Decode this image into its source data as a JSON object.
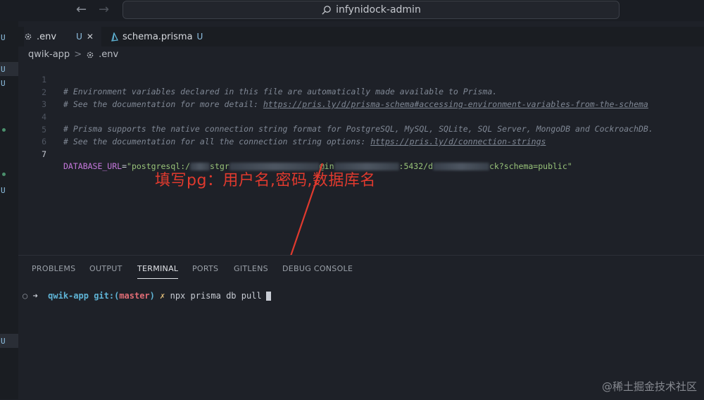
{
  "titlebar": {
    "search_text": "infynidock-admin",
    "back_icon": "arrow-left-icon",
    "forward_icon": "arrow-right-icon"
  },
  "tabs": [
    {
      "icon": "gear-icon",
      "label": ".env",
      "status": "U",
      "active": true
    },
    {
      "icon": "prisma-icon",
      "label": "schema.prisma",
      "status": "U",
      "active": false
    }
  ],
  "breadcrumb": {
    "folder": "qwik-app",
    "separator": ">",
    "file": ".env"
  },
  "activity_badges": {
    "u": "U"
  },
  "editor": {
    "lines": [
      {
        "num": "1",
        "comment": "# Environment variables declared in this file are automatically made available to Prisma."
      },
      {
        "num": "2",
        "comment_prefix": "# See the documentation for more detail: ",
        "link": "https://pris.ly/d/prisma-schema#accessing-environment-variables-from-the-schema"
      },
      {
        "num": "3"
      },
      {
        "num": "4",
        "comment": "# Prisma supports the native connection string format for PostgreSQL, MySQL, SQLite, SQL Server, MongoDB and CockroachDB."
      },
      {
        "num": "5",
        "comment_prefix": "# See the documentation for all the connection string options: ",
        "link": "https://pris.ly/d/connection-strings"
      },
      {
        "num": "6"
      },
      {
        "num": "7",
        "key": "DATABASE_URL",
        "eq": "=",
        "str_a": "\"postgresql:/",
        "str_b": "stgr",
        "str_c": "@in",
        "str_d": ":5432/d",
        "str_e": "ck?schema=public\""
      }
    ]
  },
  "annotation": {
    "text": "填写pg：用户名,密码,数据库名",
    "color": "#e03a2e"
  },
  "panel": {
    "tabs": [
      "PROBLEMS",
      "OUTPUT",
      "TERMINAL",
      "PORTS",
      "GITLENS",
      "DEBUG CONSOLE"
    ],
    "active_tab": "TERMINAL",
    "terminal": {
      "circle": "○",
      "arrow": "➜",
      "dir": "qwik-app",
      "git": "git:(",
      "branch": "master",
      "git_close": ")",
      "x": "✗",
      "command": "npx prisma db pull"
    }
  },
  "watermark": "@稀土掘金技术社区"
}
